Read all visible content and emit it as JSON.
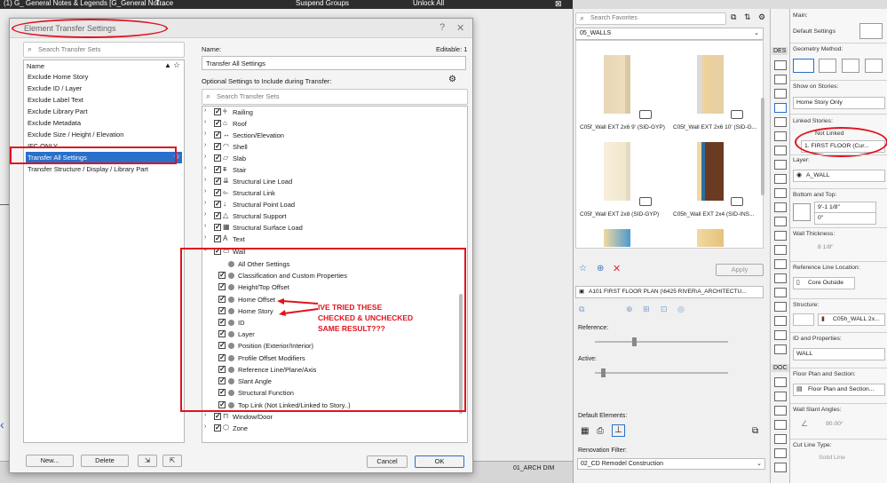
{
  "topbar": {
    "file_label": "(1) G_ General Notes & Legends [G_General Not...",
    "trace_label": "Trace",
    "suspend_label": "Suspend Groups",
    "unlock_label": "Unlock All"
  },
  "dialog": {
    "title": "Element Transfer Settings",
    "help": "?",
    "close": "✕",
    "search_placeholder": "Search Transfer Sets",
    "list_header": "Name",
    "list_items": [
      "Exclude Home Story",
      "Exclude ID / Layer",
      "Exclude Label Text",
      "Exclude Library Part",
      "Exclude Metadata",
      "Exclude Size / Height / Elevation",
      "IFC ONLY",
      "Transfer All Settings",
      "Transfer Structure / Display / Library Part"
    ],
    "selected_index": 7,
    "new_button": "New...",
    "delete_button": "Delete",
    "name_label": "Name:",
    "editable_label": "Editable: 1",
    "name_value": "Transfer All Settings",
    "optional_label": "Optional Settings to Include during Transfer:",
    "search2_placeholder": "Search Transfer Sets",
    "tree_top": [
      "Railing",
      "Roof",
      "Section/Elevation",
      "Shell",
      "Slab",
      "Stair",
      "Structural Line Load",
      "Structural Link",
      "Structural Point Load",
      "Structural Support",
      "Structural Surface Load",
      "Text"
    ],
    "wall_label": "Wall",
    "wall_children": [
      "All Other Settings",
      "Classification and Custom Properties",
      "Height/Top Offset",
      "Home Offset",
      "Home Story",
      "ID",
      "Layer",
      "Position (Exterior/Interior)",
      "Profile Offset Modifiers",
      "Reference Line/Plane/Axis",
      "Slant Angle",
      "Structural Function",
      "Top Link (Not Linked/Linked to Story..)"
    ],
    "tree_bottom": [
      "Window/Door",
      "Zone"
    ],
    "cancel_button": "Cancel",
    "ok_button": "OK"
  },
  "annotation": {
    "line1": "IVE TRIED THESE",
    "line2": "CHECKED & UNCHECKED",
    "line3": "SAME RESULT???"
  },
  "favorites": {
    "search_placeholder": "Search Favorites",
    "folder": "05_WALLS",
    "items": [
      "C05f_Wall EXT 2x6 9' (SID-GYP)",
      "C05f_Wall EXT 2x6 10' (SID-G...",
      "C05f_Wall EXT 2x8 (SID-GYP)",
      "C05h_Wall EXT 2x4 (SID-INS..."
    ],
    "apply_button": "Apply",
    "view_label": "A101 FIRST FLOOR PLAN (\\6425 RIVER\\A_ARCHITECTU...",
    "reference_label": "Reference:",
    "active_label": "Active:",
    "default_elements_label": "Default Elements:",
    "renovation_label": "Renovation Filter:",
    "renovation_value": "02_CD Remodel Construction",
    "layer_tab": "01_ARCH DIM"
  },
  "toolbox": {
    "des_label": "DES",
    "doc_label": "DOC"
  },
  "info": {
    "main_label": "Main:",
    "default_settings": "Default Settings",
    "geometry_label": "Geometry Method:",
    "show_on_stories_label": "Show on Stories:",
    "show_on_stories_value": "Home Story Only",
    "linked_stories_label": "Linked Stories:",
    "not_linked": "Not Linked",
    "first_floor": "1. FIRST FLOOR (Cur...",
    "layer_label": "Layer:",
    "layer_value": "A_WALL",
    "bottom_top_label": "Bottom and Top:",
    "top_value": "9'-1 1/8\"",
    "bottom_value": "0\"",
    "thickness_label": "Wall Thickness:",
    "thickness_value": "8 1/8\"",
    "ref_line_label": "Reference Line Location:",
    "ref_line_value": "Core Outside",
    "structure_label": "Structure:",
    "structure_value": "C05h_WALL 2x...",
    "id_label": "ID and Properties:",
    "id_value": "WALL",
    "floor_plan_label": "Floor Plan and Section:",
    "floor_plan_value": "Floor Plan and Section...",
    "slant_label": "Wall Slant Angles:",
    "slant_value": "90.00°",
    "cut_line_label": "Cut Line Type:",
    "cut_line_value": "Solid Line"
  },
  "colors": {
    "highlight": "#e0141e",
    "selection": "#2a6fc9",
    "wood": "#6b3a22",
    "insulation": "#f0d9a0"
  }
}
